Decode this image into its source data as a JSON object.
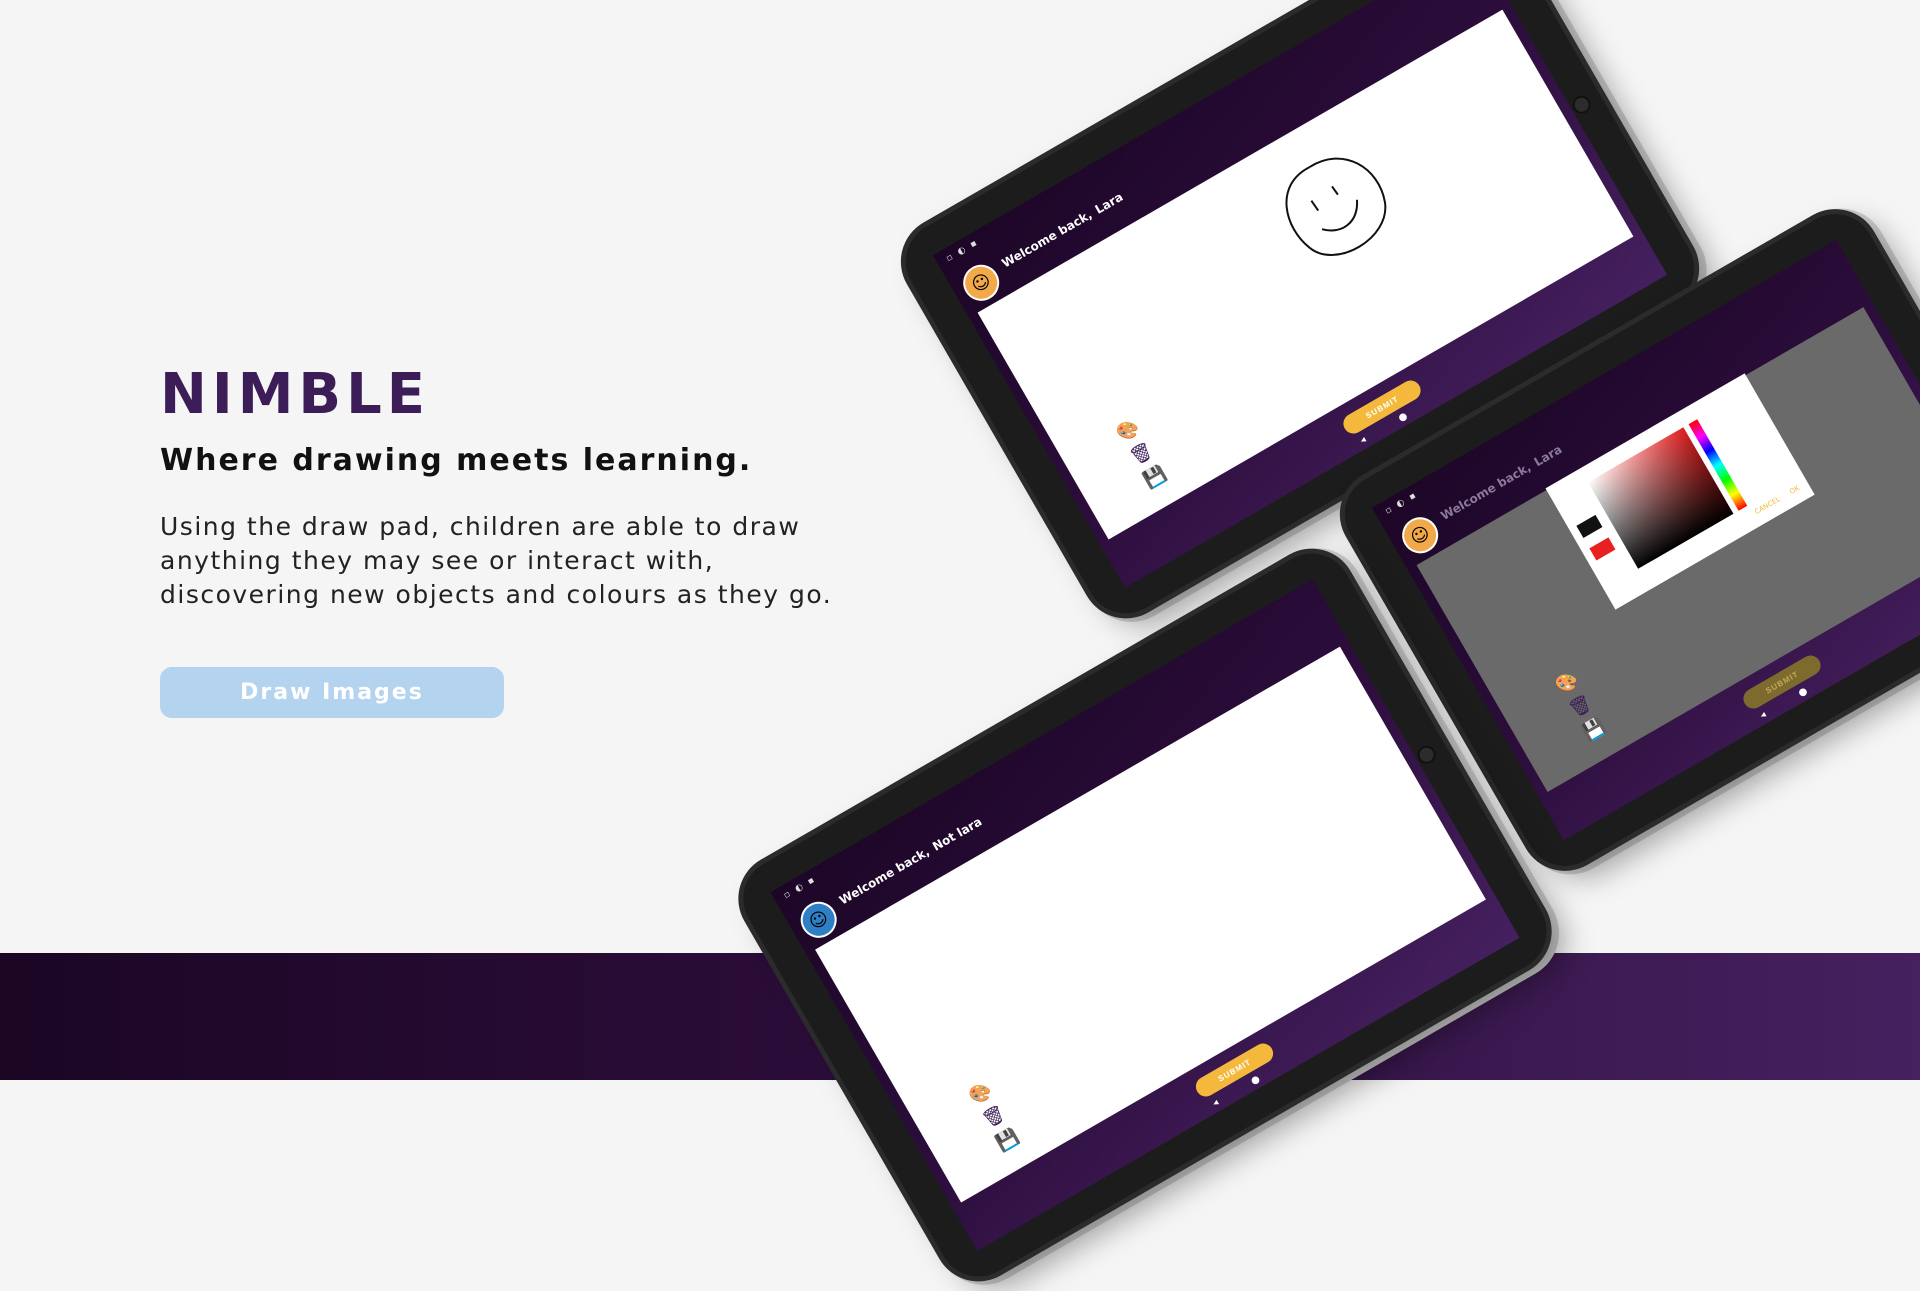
{
  "hero": {
    "brand": "NIMBLE",
    "tagline": "Where drawing meets learning.",
    "description": "Using the draw pad, children are able to draw anything they may see or interact with, discovering new objects and colours as they go.",
    "cta_label": "Draw Images"
  },
  "tablets": [
    {
      "welcome_prefix": "Welcome back,",
      "user_name": "Lara",
      "status_icons": "▫ ◐ ▪",
      "submit_label": "SUBMIT",
      "nav": "◂ ●"
    },
    {
      "welcome_prefix": "Welcome back,",
      "user_name": "Lara",
      "status_icons": "▫ ◐ ▪",
      "submit_label": "SUBMIT",
      "nav": "◂ ●",
      "picker": {
        "cancel_label": "CANCEL",
        "ok_label": "OK"
      }
    },
    {
      "welcome_prefix": "Welcome back,",
      "user_name": "Not lara",
      "status_icons": "▫ ◐ ▪",
      "submit_label": "SUBMIT",
      "nav": "◂ ●"
    }
  ],
  "colors": {
    "brand_purple": "#3c1d58",
    "cta_blue": "#b3d3ef",
    "submit_yellow": "#f4b93c",
    "footer_dark": "#1b0624",
    "footer_light": "#45215f"
  },
  "icons": [
    "palette-icon",
    "trash-icon",
    "save-icon",
    "avatar-icon"
  ]
}
